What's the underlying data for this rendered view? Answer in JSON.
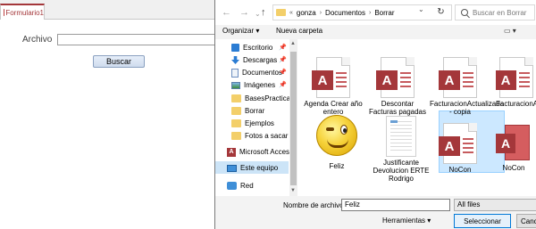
{
  "access_form": {
    "tab_label": "Formulario1",
    "archivo_label": "Archivo",
    "archivo_value": "",
    "buscar_label": "Buscar"
  },
  "dialog": {
    "nav": {
      "back": "←",
      "forward": "→",
      "recent": "⌄",
      "up": "↑",
      "refresh": "↻"
    },
    "breadcrumb": {
      "overflow": "«",
      "parts": [
        "gonza",
        "Documentos",
        "Borrar"
      ]
    },
    "search_placeholder": "Buscar en Borrar",
    "toolbar": {
      "organize": "Organizar ▾",
      "new_folder": "Nueva carpeta"
    },
    "sidebar": {
      "items": [
        {
          "label": "Escritorio",
          "icon": "desktop-icon",
          "pinned": true
        },
        {
          "label": "Descargas",
          "icon": "download-icon",
          "pinned": true
        },
        {
          "label": "Documentos",
          "icon": "documents-icon",
          "pinned": true
        },
        {
          "label": "Imágenes",
          "icon": "pictures-icon",
          "pinned": true
        },
        {
          "label": "BasesPracticas",
          "icon": "folder-icon"
        },
        {
          "label": "Borrar",
          "icon": "folder-icon"
        },
        {
          "label": "Ejemplos",
          "icon": "folder-icon"
        },
        {
          "label": "Fotos a sacar",
          "icon": "folder-icon"
        },
        {
          "label": "Microsoft Access",
          "icon": "access-icon"
        },
        {
          "label": "Este equipo",
          "icon": "computer-icon",
          "selected": true
        },
        {
          "label": "Red",
          "icon": "network-icon"
        }
      ]
    },
    "files": [
      {
        "name": "Agenda Crear año entero",
        "type": "access"
      },
      {
        "name": "Descontar Facturas pagadas",
        "type": "access"
      },
      {
        "name": "FacturacionActualizada - copia",
        "type": "access"
      },
      {
        "name": "FacturacionActualizada",
        "type": "access"
      },
      {
        "name": "Feliz",
        "type": "image",
        "selected": true
      },
      {
        "name": "Justificante Devolucion ERTE Rodrigo",
        "type": "pdf"
      },
      {
        "name": "NoCon",
        "type": "access"
      },
      {
        "name": "NoCon",
        "type": "access-app"
      }
    ],
    "bottom": {
      "filename_label": "Nombre de archivo:",
      "filename_value": "Feliz",
      "filetype_value": "All files",
      "tools_label": "Herramientas   ▾",
      "open_label": "Seleccionar",
      "cancel_label": "Cancel"
    }
  }
}
